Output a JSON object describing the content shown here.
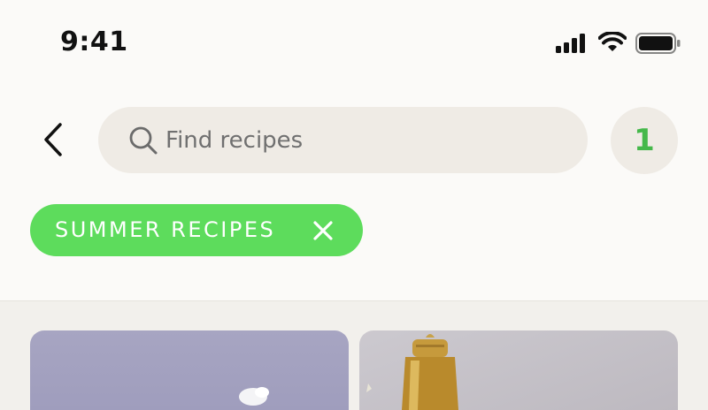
{
  "status_bar": {
    "time": "9:41",
    "icons": [
      "cellular-signal-icon",
      "wifi-icon",
      "battery-icon"
    ]
  },
  "header": {
    "back_icon": "chevron-left-icon",
    "search": {
      "placeholder": "Find recipes",
      "icon": "search-icon"
    },
    "cart_count": "1"
  },
  "filters": [
    {
      "label": "SUMMER RECIPES",
      "remove_icon": "close-icon"
    }
  ],
  "cards": [
    {
      "image": "white-flower-on-lavender-background"
    },
    {
      "image": "gold-cocktail-shaker"
    }
  ],
  "colors": {
    "accent_green": "#5ddc5c",
    "count_green": "#45b84a",
    "search_bg": "#efebe5",
    "page_bg": "#fbfaf8"
  }
}
